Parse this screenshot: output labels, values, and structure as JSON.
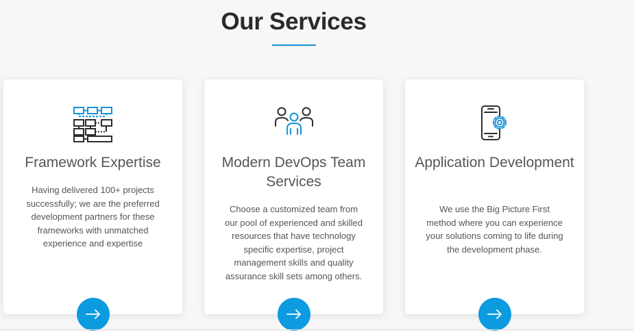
{
  "section": {
    "title": "Our Services"
  },
  "colors": {
    "accent": "#0d9be0",
    "icon_dark": "#2d2d2d",
    "icon_blue": "#1493d9"
  },
  "cards": [
    {
      "icon": "framework-diagram-icon",
      "title": "Framework Expertise",
      "description": "Having delivered 100+ projects successfully; we are the preferred development partners for these frameworks with unmatched experience and expertise",
      "button_icon": "arrow-right-icon"
    },
    {
      "icon": "team-people-icon",
      "title": "Modern DevOps Team Services",
      "description": "Choose a customized team from our pool of experienced and skilled resources that have technology specific expertise, project management skills and quality assurance skill sets among others.",
      "button_icon": "arrow-right-icon"
    },
    {
      "icon": "mobile-gear-icon",
      "title": "Application Development",
      "description": "We use the Big Picture First method where you can experience your solutions coming to life during the development phase.",
      "button_icon": "arrow-right-icon"
    }
  ]
}
